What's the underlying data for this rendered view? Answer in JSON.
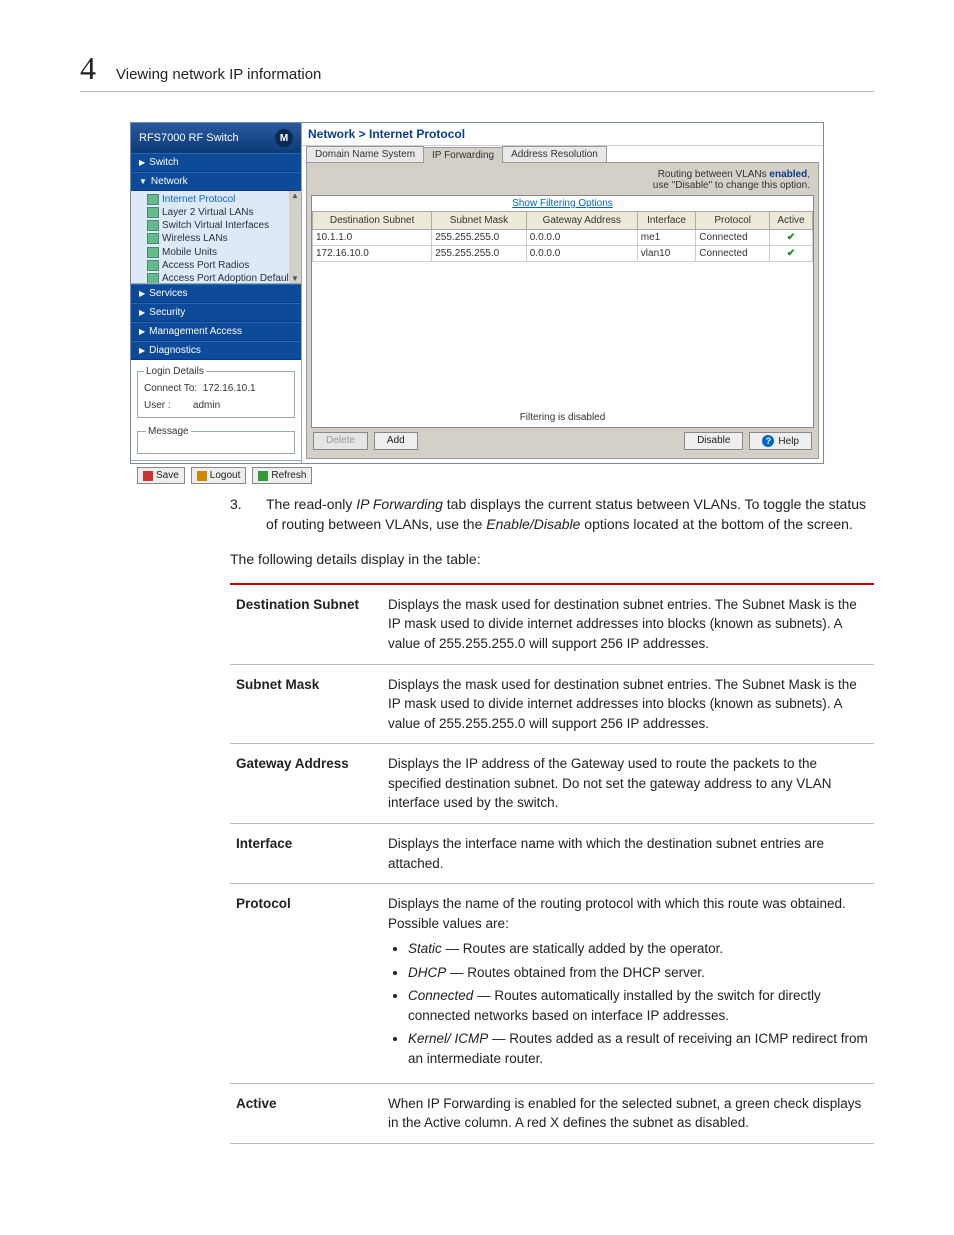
{
  "header": {
    "chapter": "4",
    "title": "Viewing network IP information"
  },
  "shot": {
    "brand": "RFS7000 RF Switch",
    "nav": {
      "switch": "Switch",
      "network": "Network",
      "services": "Services",
      "security": "Security",
      "mgmt": "Management Access",
      "diag": "Diagnostics"
    },
    "tree": [
      "Internet Protocol",
      "Layer 2 Virtual LANs",
      "Switch Virtual Interfaces",
      "Wireless LANs",
      "Mobile Units",
      "Access Port Radios",
      "Access Port Adoption Defaults"
    ],
    "login": {
      "legend": "Login Details",
      "connect_l": "Connect To:",
      "connect_v": "172.16.10.1",
      "user_l": "User :",
      "user_v": "admin"
    },
    "msg_legend": "Message",
    "toolbar": {
      "save": "Save",
      "logout": "Logout",
      "refresh": "Refresh"
    },
    "crumb": "Network > Internet Protocol",
    "tabs": {
      "dns": "Domain Name System",
      "ipf": "IP Forwarding",
      "ar": "Address Resolution"
    },
    "note1": "Routing between VLANs ",
    "note1b": "enabled",
    "note1c": ",",
    "note2": "use \"Disable\" to change this option.",
    "show_filter": "Show Filtering Options",
    "cols": {
      "c1": "Destination Subnet",
      "c2": "Subnet Mask",
      "c3": "Gateway Address",
      "c4": "Interface",
      "c5": "Protocol",
      "c6": "Active"
    },
    "rows": [
      {
        "d": "10.1.1.0",
        "m": "255.255.255.0",
        "g": "0.0.0.0",
        "i": "me1",
        "p": "Connected",
        "a": "✔"
      },
      {
        "d": "172.16.10.0",
        "m": "255.255.255.0",
        "g": "0.0.0.0",
        "i": "vlan10",
        "p": "Connected",
        "a": "✔"
      }
    ],
    "filter_disabled": "Filtering is disabled",
    "btns": {
      "delete": "Delete",
      "add": "Add",
      "disable": "Disable",
      "help": "Help"
    }
  },
  "step3": {
    "n": "3.",
    "a": "The read-only ",
    "b": "IP Forwarding",
    "c": " tab displays the current status between VLANs. To toggle the status of routing between VLANs, use the ",
    "d": "Enable/Disable",
    "e": " options located at the bottom of the screen."
  },
  "intro": "The following details display in the table:",
  "desc": {
    "r1k": "Destination Subnet",
    "r1v": "Displays the mask used for destination subnet entries. The Subnet Mask is the IP mask used to divide internet addresses into blocks (known as subnets). A value of 255.255.255.0 will support 256 IP addresses.",
    "r2k": "Subnet Mask",
    "r2v": "Displays the mask used for destination subnet entries. The Subnet Mask is the IP mask used to divide internet addresses into blocks (known as subnets). A value of 255.255.255.0 will support 256 IP addresses.",
    "r3k": "Gateway Address",
    "r3v": "Displays the IP address of the Gateway used to route the packets to the specified destination subnet. Do not set the gateway address to any VLAN interface used by the switch.",
    "r4k": "Interface",
    "r4v": "Displays the interface name with which the destination subnet entries are attached.",
    "r5k": "Protocol",
    "r5v": "Displays the name of the routing protocol with which this route was obtained. Possible values are:",
    "r5l1a": "Static",
    "r5l1b": " — Routes are statically added by the operator.",
    "r5l2a": "DHCP",
    "r5l2b": " — Routes obtained from the DHCP server.",
    "r5l3a": "Connected",
    "r5l3b": " — Routes automatically installed by the switch for directly connected networks based on interface IP addresses.",
    "r5l4a": "Kernel/ ICMP",
    "r5l4b": " — Routes added as a result of receiving an ICMP redirect from an intermediate router.",
    "r6k": "Active",
    "r6v": "When IP Forwarding is enabled for the selected subnet, a green check displays in the Active column. A red X defines the subnet as disabled."
  }
}
